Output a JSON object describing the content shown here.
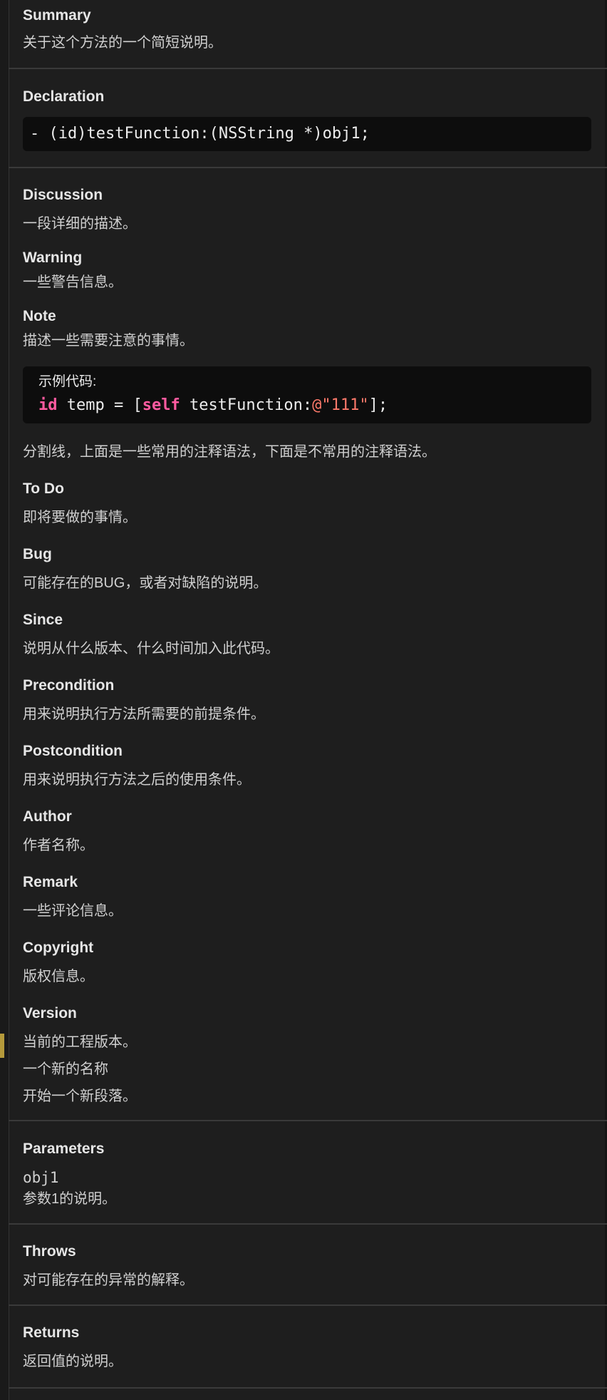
{
  "summary": {
    "heading": "Summary",
    "text": "关于这个方法的一个简短说明。"
  },
  "declaration": {
    "heading": "Declaration",
    "code": "- (id)testFunction:(NSString *)obj1;"
  },
  "discussion": {
    "heading": "Discussion",
    "text": "一段详细的描述。",
    "warning_heading": "Warning",
    "warning_text": "一些警告信息。",
    "note_heading": "Note",
    "note_text": "描述一些需要注意的事情。",
    "example": {
      "caption": "示例代码:",
      "kw_id": "id",
      "part1": " temp = [",
      "kw_self": "self",
      "part2": " testFunction:",
      "literal": "@\"111\"",
      "part3": "];"
    },
    "separator_text": "分割线，上面是一些常用的注释语法，下面是不常用的注释语法。",
    "items": [
      {
        "heading": "To Do",
        "text": "即将要做的事情。"
      },
      {
        "heading": "Bug",
        "text": "可能存在的BUG，或者对缺陷的说明。"
      },
      {
        "heading": "Since",
        "text": "说明从什么版本、什么时间加入此代码。"
      },
      {
        "heading": "Precondition",
        "text": "用来说明执行方法所需要的前提条件。"
      },
      {
        "heading": "Postcondition",
        "text": "用来说明执行方法之后的使用条件。"
      },
      {
        "heading": "Author",
        "text": "作者名称。"
      },
      {
        "heading": "Remark",
        "text": "一些评论信息。"
      },
      {
        "heading": "Copyright",
        "text": "版权信息。"
      },
      {
        "heading": "Version",
        "text": "当前的工程版本。"
      }
    ],
    "version_extra": [
      "一个新的名称",
      "开始一个新段落。"
    ]
  },
  "parameters": {
    "heading": "Parameters",
    "name": "obj1",
    "text": "参数1的说明。"
  },
  "throws": {
    "heading": "Throws",
    "text": "对可能存在的异常的解释。"
  },
  "returns": {
    "heading": "Returns",
    "text": "返回值的说明。"
  },
  "colors": {
    "background": "#1e1e1e",
    "code_background": "#0d0d0d",
    "keyword": "#ff5ba0",
    "string": "#ff7a6b",
    "marker": "#b59a3b"
  }
}
